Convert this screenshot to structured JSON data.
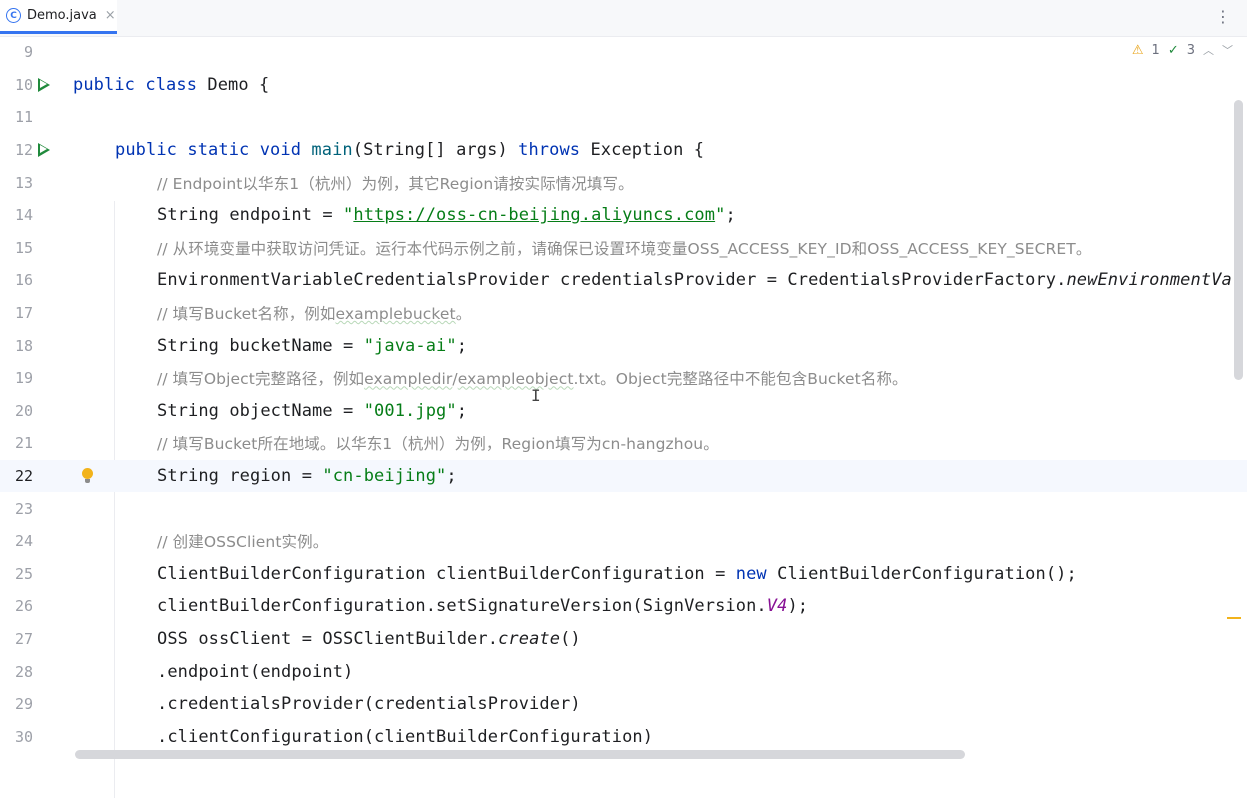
{
  "tab": {
    "label": "Demo.java",
    "close": "×"
  },
  "toolbar": {
    "more": "⋮"
  },
  "inspection": {
    "warnings": "1",
    "weak_warnings": "3",
    "up": "^",
    "down": "v"
  },
  "lines": {
    "l9": {
      "num": "9"
    },
    "l10": {
      "num": "10",
      "kw1": "public",
      "kw2": "class",
      "rest": " Demo {"
    },
    "l11": {
      "num": "11"
    },
    "l12": {
      "num": "12",
      "kw1": "public",
      "kw2": "static",
      "kw3": "void",
      "fn": "main",
      "mid": "(String[] args) ",
      "kw4": "throws",
      "rest": " Exception {"
    },
    "l13": {
      "num": "13",
      "comment": "// Endpoint以华东1（杭州）为例，其它Region请按实际情况填写。"
    },
    "l14": {
      "num": "14",
      "pre": "String endpoint = ",
      "q1": "\"",
      "url": "https://oss-cn-beijing.aliyuncs.com",
      "q2": "\"",
      "post": ";"
    },
    "l15": {
      "num": "15",
      "comment": "// 从环境变量中获取访问凭证。运行本代码示例之前，请确保已设置环境变量OSS_ACCESS_KEY_ID和OSS_ACCESS_KEY_SECRET。"
    },
    "l16": {
      "num": "16",
      "pre": "EnvironmentVariableCredentialsProvider credentialsProvider = CredentialsProviderFactory.",
      "it": "newEnvironmentVa"
    },
    "l17": {
      "num": "17",
      "c1": "// 填写Bucket名称，例如",
      "c2": "examplebucket",
      "c3": "。"
    },
    "l18": {
      "num": "18",
      "pre": "String bucketName = ",
      "str": "\"java-ai\"",
      "post": ";"
    },
    "l19": {
      "num": "19",
      "c1": "// 填写Object完整路径，例如",
      "c2": "exampledir",
      "c3": "/",
      "c4": "exampleobject",
      "c5": ".txt。Object完整路径中不能包含Bucket名称。"
    },
    "l20": {
      "num": "20",
      "pre": "String objectName = ",
      "str": "\"001.jpg\"",
      "post": ";"
    },
    "l21": {
      "num": "21",
      "comment": "// 填写Bucket所在地域。以华东1（杭州）为例，Region填写为cn-hangzhou。"
    },
    "l22": {
      "num": "22",
      "pre": "String region = ",
      "str": "\"cn-beijing\"",
      "post": ";"
    },
    "l23": {
      "num": "23"
    },
    "l24": {
      "num": "24",
      "comment": "// 创建OSSClient实例。"
    },
    "l25": {
      "num": "25",
      "pre": "ClientBuilderConfiguration clientBuilderConfiguration = ",
      "kw": "new",
      "post": " ClientBuilderConfiguration();"
    },
    "l26": {
      "num": "26",
      "pre": "clientBuilderConfiguration.setSignatureVersion(SignVersion.",
      "fld": "V4",
      "post": ");"
    },
    "l27": {
      "num": "27",
      "pre": "OSS ossClient = OSSClientBuilder.",
      "it": "create",
      "post": "()"
    },
    "l28": {
      "num": "28",
      "code": ".endpoint(endpoint)"
    },
    "l29": {
      "num": "29",
      "code": ".credentialsProvider(credentialsProvider)"
    },
    "l30": {
      "num": "30",
      "code": ".clientConfiguration(clientBuilderConfiguration)"
    }
  },
  "colors": {
    "keyword": "#0033b3",
    "string": "#067d17",
    "comment": "#8c8c8c",
    "accent": "#3574f0"
  }
}
